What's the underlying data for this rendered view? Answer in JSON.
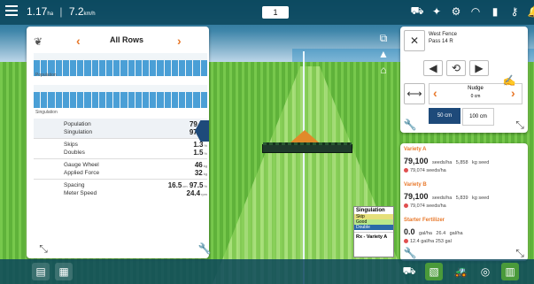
{
  "topbar": {
    "speed_a": "1.17",
    "speed_a_unit": "ha",
    "speed_b": "7.2",
    "speed_b_unit": "km/h",
    "pass": "1"
  },
  "left_panel": {
    "title": "All Rows",
    "charts": [
      {
        "label": "Population",
        "scale_top": "100",
        "scale_bot": "50"
      },
      {
        "label": "Singulation",
        "scale_top": "100",
        "scale_bot": "95"
      }
    ],
    "stats": [
      {
        "label": "Population",
        "value": "79.5k",
        "unit": ""
      },
      {
        "label": "Singulation",
        "value": "97.2",
        "unit": "%"
      },
      {
        "label": "Skips",
        "value": "1.3",
        "unit": "%"
      },
      {
        "label": "Doubles",
        "value": "1.5",
        "unit": "%"
      },
      {
        "label": "Gauge Wheel",
        "value": "46",
        "unit": "kg"
      },
      {
        "label": "Applied Force",
        "value": "32",
        "unit": "kg"
      },
      {
        "label": "Spacing",
        "value": "16.5",
        "unit": "cm",
        "value2": "97.5",
        "unit2": "%"
      },
      {
        "label": "Meter Speed",
        "value": "24.4",
        "unit": "rpm"
      }
    ]
  },
  "right_panel": {
    "field_name": "West Fence",
    "pass_name": "Pass 14 R",
    "nudge_label": "Nudge",
    "nudge_value": "0 cm",
    "step_a": "50 cm",
    "step_b": "100 cm"
  },
  "varieties": [
    {
      "name": "Variety A",
      "main": "79,100",
      "main_unit": "seeds/ha",
      "area": "5,858",
      "area_unit": "kg seed",
      "sub": "79,074",
      "sub_unit": "seeds/ha"
    },
    {
      "name": "Variety B",
      "main": "79,100",
      "main_unit": "seeds/ha",
      "area": "5,839",
      "area_unit": "kg seed",
      "sub": "79,074",
      "sub_unit": "seeds/ha"
    },
    {
      "name": "Starter Fertilizer",
      "main": "0.0",
      "main_unit": "gal/ha",
      "area": "26.4",
      "area_unit": "gal/ha",
      "sub": "12.4",
      "sub_unit": "gal/ha",
      "sub2": "253",
      "sub2_unit": "gal"
    }
  ],
  "singulation_legend": {
    "title": "Singulation",
    "items": [
      "Skip",
      "Good",
      "Double"
    ],
    "footer": "Rx - Variety A"
  },
  "colors": {
    "accent": "#e8782a",
    "blue": "#1e4a7a",
    "bar": "#4a9fd6",
    "bar_bg": "#0c465c"
  }
}
